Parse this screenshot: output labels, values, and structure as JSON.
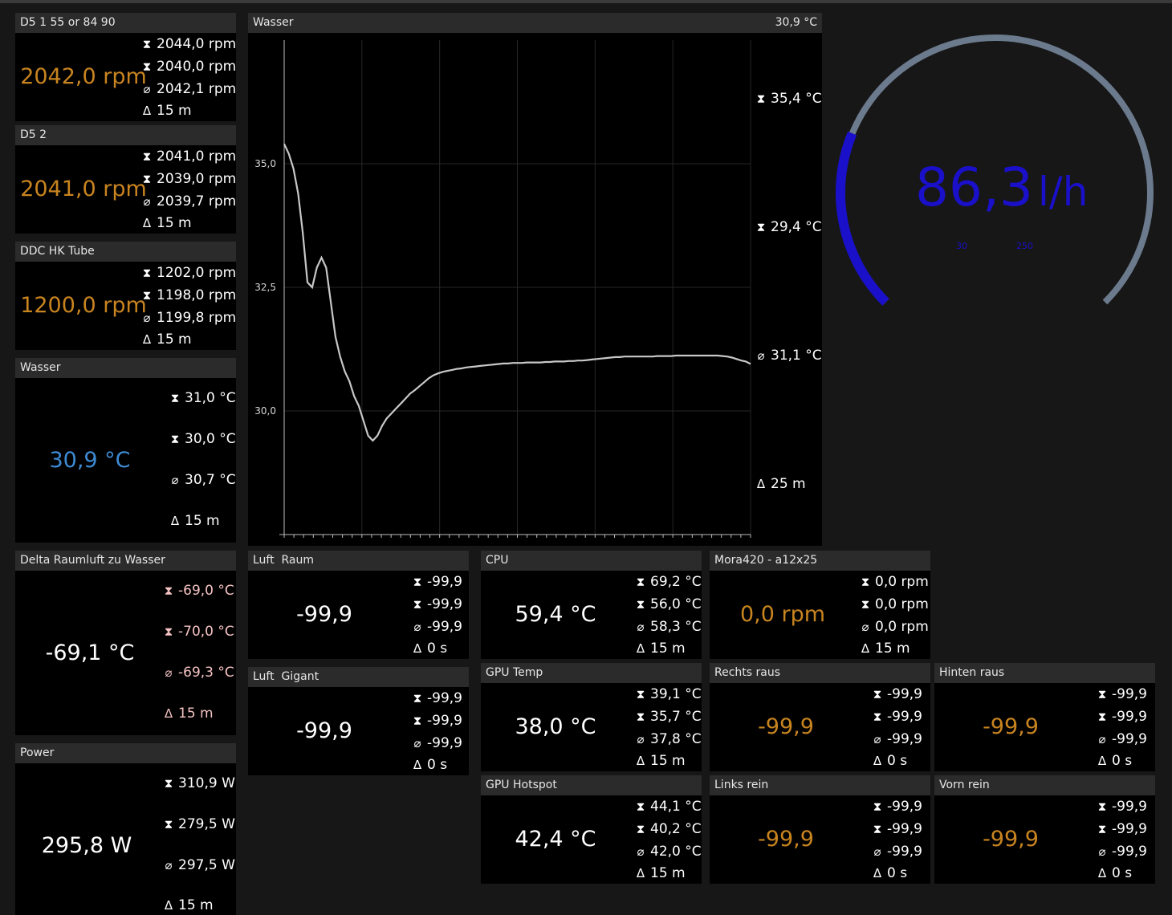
{
  "colors": {
    "accent_orange": "#c8841f",
    "accent_blue": "#3e8ad3",
    "gauge_blue": "#1a10c9",
    "gauge_track": "#6b7a8c",
    "pink": "#f4c2c2"
  },
  "icons": {
    "max": "max-hourglass-icon",
    "min": "min-hourglass-icon",
    "avg": "average-icon",
    "delta_t": "delta-t-icon"
  },
  "tiles": {
    "d5_1": {
      "title": "D5 1 55 or 84 90",
      "value": "2042,0 rpm",
      "max": "2044,0 rpm",
      "min": "2040,0 rpm",
      "avg": "2042,1 rpm",
      "dt": "15 m"
    },
    "d5_2": {
      "title": "D5 2",
      "value": "2041,0 rpm",
      "max": "2041,0 rpm",
      "min": "2039,0 rpm",
      "avg": "2039,7 rpm",
      "dt": "15 m"
    },
    "ddc": {
      "title": "DDC HK Tube",
      "value": "1200,0 rpm",
      "max": "1202,0 rpm",
      "min": "1198,0 rpm",
      "avg": "1199,8 rpm",
      "dt": "15 m"
    },
    "wasser": {
      "title": "Wasser",
      "value": "30,9 °C",
      "max": "31,0 °C",
      "min": "30,0 °C",
      "avg": "30,7 °C",
      "dt": "15 m"
    },
    "delta": {
      "title": "Delta Raumluft zu Wasser",
      "value": "-69,1 °C",
      "max": "-69,0 °C",
      "min": "-70,0 °C",
      "avg": "-69,3 °C",
      "dt": "15 m"
    },
    "power": {
      "title": "Power",
      "value": "295,8 W",
      "max": "310,9 W",
      "min": "279,5 W",
      "avg": "297,5 W",
      "dt": "15 m"
    },
    "luft_raum": {
      "title": "Luft  Raum",
      "value": "-99,9",
      "max": "-99,9",
      "min": "-99,9",
      "avg": "-99,9",
      "dt": "0 s"
    },
    "luft_gigant": {
      "title": "Luft  Gigant",
      "value": "-99,9",
      "max": "-99,9",
      "min": "-99,9",
      "avg": "-99,9",
      "dt": "0 s"
    },
    "cpu": {
      "title": "CPU",
      "value": "59,4 °C",
      "max": "69,2 °C",
      "min": "56,0 °C",
      "avg": "58,3 °C",
      "dt": "15 m"
    },
    "gpu_temp": {
      "title": "GPU Temp",
      "value": "38,0 °C",
      "max": "39,1 °C",
      "min": "35,7 °C",
      "avg": "37,8 °C",
      "dt": "15 m"
    },
    "gpu_hot": {
      "title": "GPU Hotspot",
      "value": "42,4 °C",
      "max": "44,1 °C",
      "min": "40,2 °C",
      "avg": "42,0 °C",
      "dt": "15 m"
    },
    "mora": {
      "title": "Mora420 - a12x25",
      "value": "0,0 rpm",
      "max": "0,0 rpm",
      "min": "0,0 rpm",
      "avg": "0,0 rpm",
      "dt": "15 m"
    },
    "rechts": {
      "title": "Rechts raus",
      "value": "-99,9",
      "max": "-99,9",
      "min": "-99,9",
      "avg": "-99,9",
      "dt": "0 s"
    },
    "links": {
      "title": "Links rein",
      "value": "-99,9",
      "max": "-99,9",
      "min": "-99,9",
      "avg": "-99,9",
      "dt": "0 s"
    },
    "hinten": {
      "title": "Hinten raus",
      "value": "-99,9",
      "max": "-99,9",
      "min": "-99,9",
      "avg": "-99,9",
      "dt": "0 s"
    },
    "vorn": {
      "title": "Vorn rein",
      "value": "-99,9",
      "max": "-99,9",
      "min": "-99,9",
      "avg": "-99,9",
      "dt": "0 s"
    }
  },
  "graph": {
    "title": "Wasser",
    "current": "30,9 °C",
    "max": "35,4 °C",
    "min": "29,4 °C",
    "avg": "31,1 °C",
    "dt": "25 m"
  },
  "gauge": {
    "value": "86,3",
    "unit": "l/h",
    "scale_min": "30",
    "scale_max": "250",
    "fraction": 0.25
  },
  "chart_data": {
    "type": "line",
    "title": "Wasser",
    "ylim": [
      27.5,
      37.5
    ],
    "y_ticks": [
      "35,0",
      "32,5",
      "30,0"
    ],
    "grid": true,
    "series": [
      {
        "x": [
          0,
          1,
          2,
          3,
          4,
          5,
          6,
          7,
          8,
          9,
          10,
          11,
          12,
          13,
          14,
          15,
          16,
          17,
          18,
          19,
          20,
          21,
          22,
          23,
          24,
          25,
          26,
          27,
          28,
          29,
          30,
          31,
          32,
          33,
          34,
          35,
          36,
          37,
          38,
          39,
          40,
          41,
          42,
          43,
          44,
          45,
          46,
          47,
          48,
          49,
          50,
          51,
          52,
          53,
          54,
          55,
          56,
          57,
          58,
          59,
          60,
          61,
          62,
          63,
          64,
          65,
          66,
          67,
          68,
          69,
          70,
          71,
          72,
          73,
          74,
          75,
          76,
          77,
          78,
          79,
          80,
          81,
          82,
          83,
          84,
          85,
          86,
          87,
          88,
          89,
          90,
          91,
          92,
          93,
          94,
          95,
          96,
          97,
          98,
          99,
          100
        ],
        "values": [
          35.4,
          35.2,
          34.9,
          34.4,
          33.6,
          32.6,
          32.5,
          32.9,
          33.1,
          32.9,
          32.2,
          31.5,
          31.1,
          30.8,
          30.6,
          30.3,
          30.1,
          29.8,
          29.5,
          29.4,
          29.5,
          29.7,
          29.85,
          29.95,
          30.05,
          30.15,
          30.25,
          30.35,
          30.42,
          30.5,
          30.58,
          30.66,
          30.72,
          30.76,
          30.79,
          30.81,
          30.83,
          30.85,
          30.86,
          30.88,
          30.89,
          30.9,
          30.91,
          30.92,
          30.93,
          30.94,
          30.95,
          30.96,
          30.96,
          30.97,
          30.97,
          30.97,
          30.98,
          30.98,
          30.98,
          30.98,
          30.99,
          30.99,
          31.0,
          31.0,
          31.0,
          31.01,
          31.01,
          31.02,
          31.02,
          31.03,
          31.04,
          31.05,
          31.06,
          31.07,
          31.08,
          31.09,
          31.09,
          31.1,
          31.1,
          31.1,
          31.1,
          31.1,
          31.1,
          31.1,
          31.11,
          31.11,
          31.11,
          31.11,
          31.12,
          31.12,
          31.12,
          31.12,
          31.12,
          31.12,
          31.12,
          31.12,
          31.12,
          31.12,
          31.11,
          31.1,
          31.08,
          31.05,
          31.02,
          31.0,
          30.95
        ]
      }
    ]
  }
}
